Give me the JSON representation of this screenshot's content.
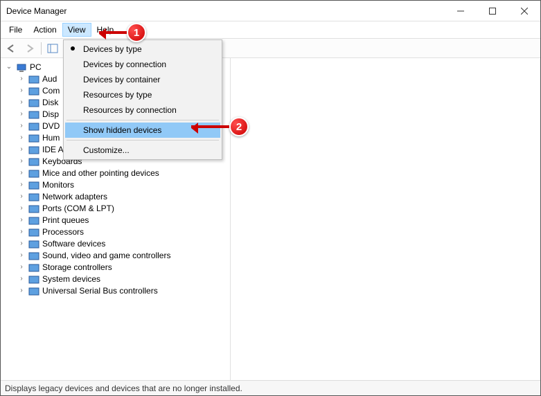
{
  "window": {
    "title": "Device Manager"
  },
  "menu": {
    "items": [
      "File",
      "Action",
      "View",
      "Help"
    ],
    "open_index": 2
  },
  "dropdown": {
    "groups": [
      {
        "items": [
          {
            "label": "Devices by type",
            "bullet": true
          },
          {
            "label": "Devices by connection"
          },
          {
            "label": "Devices by container"
          },
          {
            "label": "Resources by type"
          },
          {
            "label": "Resources by connection"
          }
        ]
      },
      {
        "items": [
          {
            "label": "Show hidden devices",
            "highlighted": true
          }
        ]
      },
      {
        "items": [
          {
            "label": "Customize..."
          }
        ]
      }
    ]
  },
  "tree": {
    "root": {
      "label": "PC",
      "expanded": true
    },
    "children": [
      {
        "label": "Audio inputs and outputs",
        "trunc": "Aud"
      },
      {
        "label": "Computer",
        "trunc": "Com"
      },
      {
        "label": "Disk drives",
        "trunc": "Disk"
      },
      {
        "label": "Display adapters",
        "trunc": "Disp"
      },
      {
        "label": "DVD/CD-ROM drives",
        "trunc": "DVD"
      },
      {
        "label": "Human Interface Devices",
        "trunc": "Hum"
      },
      {
        "label": "IDE ATA/ATAPI controllers",
        "trunc": "IDE A"
      },
      {
        "label": "Keyboards"
      },
      {
        "label": "Mice and other pointing devices"
      },
      {
        "label": "Monitors"
      },
      {
        "label": "Network adapters"
      },
      {
        "label": "Ports (COM & LPT)"
      },
      {
        "label": "Print queues"
      },
      {
        "label": "Processors"
      },
      {
        "label": "Software devices"
      },
      {
        "label": "Sound, video and game controllers"
      },
      {
        "label": "Storage controllers"
      },
      {
        "label": "System devices"
      },
      {
        "label": "Universal Serial Bus controllers"
      }
    ],
    "covered_count": 7
  },
  "statusbar": {
    "text": "Displays legacy devices and devices that are no longer installed."
  },
  "annotations": {
    "one": "1",
    "two": "2"
  },
  "icons_svg": {
    "pc": "<svg viewBox='0 0 16 16'><rect x='2' y='3' width='12' height='8' fill='#3a7bd5' stroke='#2a5a9a'/><rect x='5' y='12' width='6' height='2' fill='#888'/></svg>",
    "generic": "<svg viewBox='0 0 16 16'><rect x='1' y='3' width='14' height='10' fill='#5ea0e0' stroke='#2a5a9a'/></svg>"
  }
}
